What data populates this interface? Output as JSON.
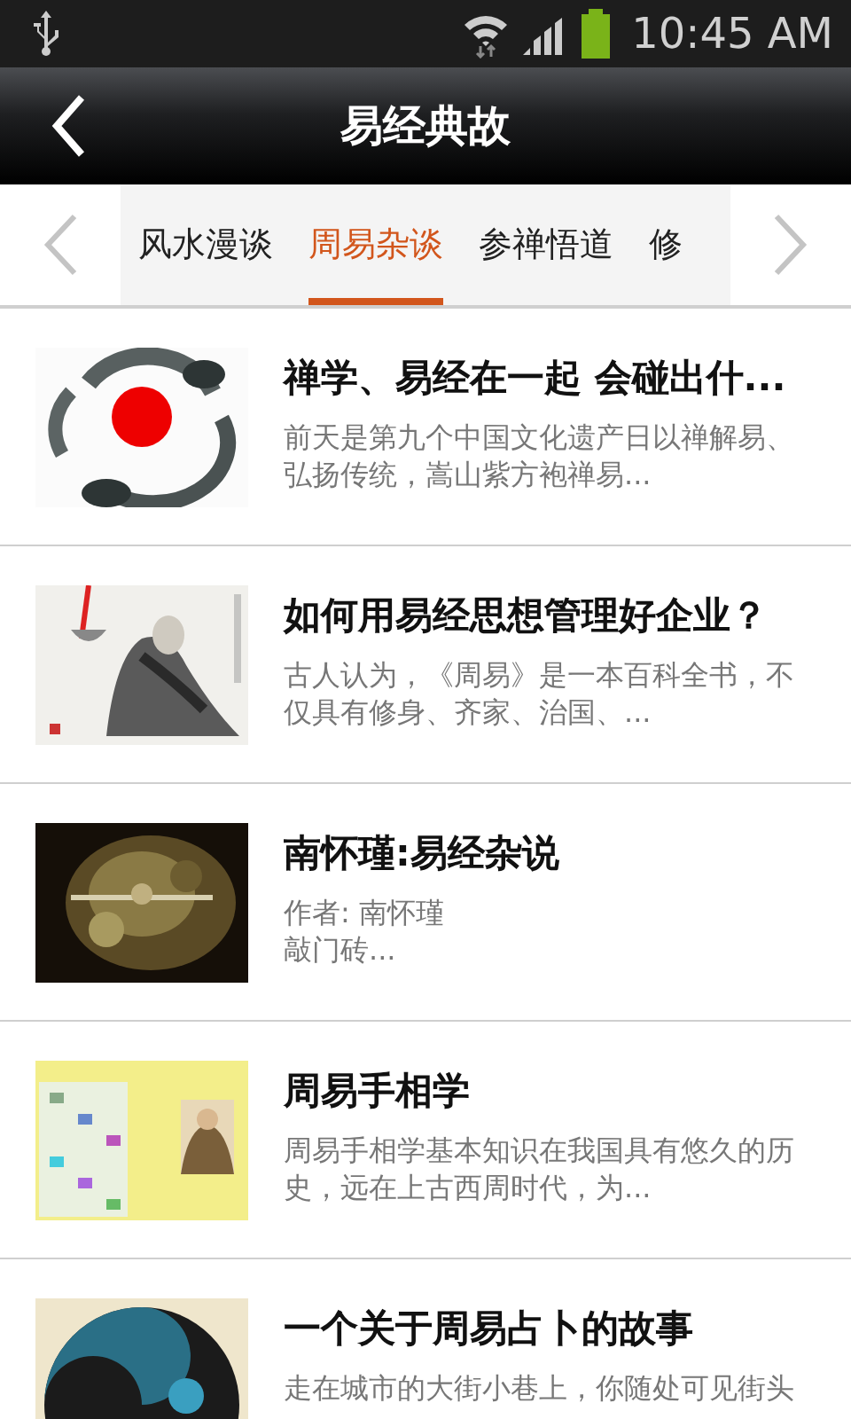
{
  "status_bar": {
    "time": "10:45 AM"
  },
  "header": {
    "title": "易经典故"
  },
  "tabs": [
    {
      "label": "风水漫谈",
      "selected": false
    },
    {
      "label": "周易杂谈",
      "selected": true
    },
    {
      "label": "参禅悟道",
      "selected": false
    },
    {
      "label": "修",
      "selected": false
    }
  ],
  "articles": [
    {
      "title": "禅学、易经在一起 会碰出什...",
      "summary": "前天是第九个中国文化遗产日以禅解易、弘扬传统，嵩山紫方袍禅易..."
    },
    {
      "title": "如何用易经思想管理好企业？",
      "summary": "古人认为，《周易》是一本百科全书，不仅具有修身、齐家、治国、..."
    },
    {
      "title": "南怀瑾:易经杂说",
      "summary": [
        "作者: 南怀瑾",
        "敲门砖..."
      ]
    },
    {
      "title": "周易手相学",
      "summary": "周易手相学基本知识在我国具有悠久的历史，远在上古西周时代，为..."
    },
    {
      "title": "一个关于周易占卜的故事",
      "summary": "走在城市的大街小巷上，你随处可见街头"
    }
  ]
}
